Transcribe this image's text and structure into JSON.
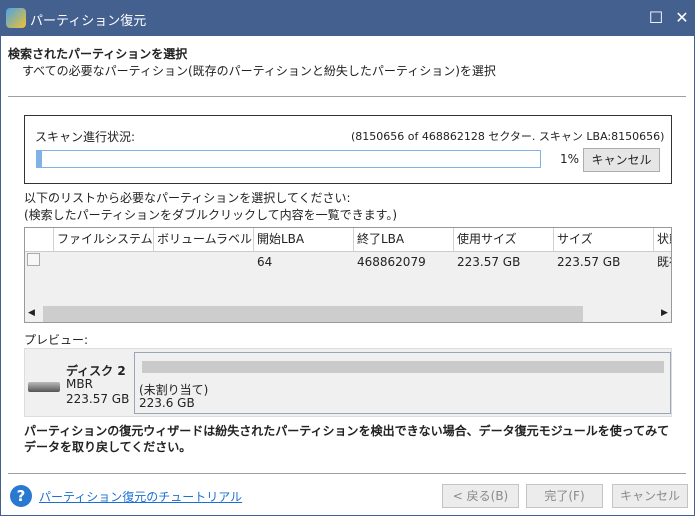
{
  "window": {
    "title": "パーティション復元",
    "maximize_icon": "maximize-icon",
    "close_icon": "close-icon"
  },
  "header": {
    "title": "検索されたパーティションを選択",
    "subtitle": "すべての必要なパーティション(既存のパーティションと紛失したパーティション)を選択"
  },
  "scan": {
    "label": "スキャン進行状況:",
    "detail": "(8150656 of 468862128 セクター. スキャン LBA:8150656)",
    "progress_percent": 1,
    "percent_text": "1%",
    "cancel_label": "キャンセル"
  },
  "list": {
    "instruction1": "以下のリストから必要なパーティションを選択してください:",
    "instruction2": "(検索したパーティションをダブルクリックして内容を一覧できます。)",
    "columns": [
      "",
      "ファイルシステム",
      "ボリュームラベル",
      "開始LBA",
      "終了LBA",
      "使用サイズ",
      "サイズ",
      "状態"
    ],
    "rows": [
      {
        "checked": false,
        "cells": [
          "",
          "",
          "64",
          "468862079",
          "223.57 GB",
          "223.57 GB",
          "既存"
        ]
      }
    ]
  },
  "preview": {
    "label": "プレビュー:",
    "disk_name": "ディスク 2",
    "disk_type": "MBR",
    "disk_size": "223.57 GB",
    "partition_label": "(未割り当て)",
    "partition_size": "223.6 GB"
  },
  "warning": "パーティションの復元ウィザードは紛失されたパーティションを検出できない場合、データ復元モジュールを使ってみてデータを取り戻してください。",
  "footer": {
    "tutorial_link": "パーティション復元のチュートリアル",
    "back_label": "< 戻る(B)",
    "finish_label": "完了(F)",
    "cancel_label": "キャンセル"
  },
  "colors": {
    "titlebar": "#44608f",
    "progress": "#7fb2e5",
    "link": "#1a6fd6"
  }
}
